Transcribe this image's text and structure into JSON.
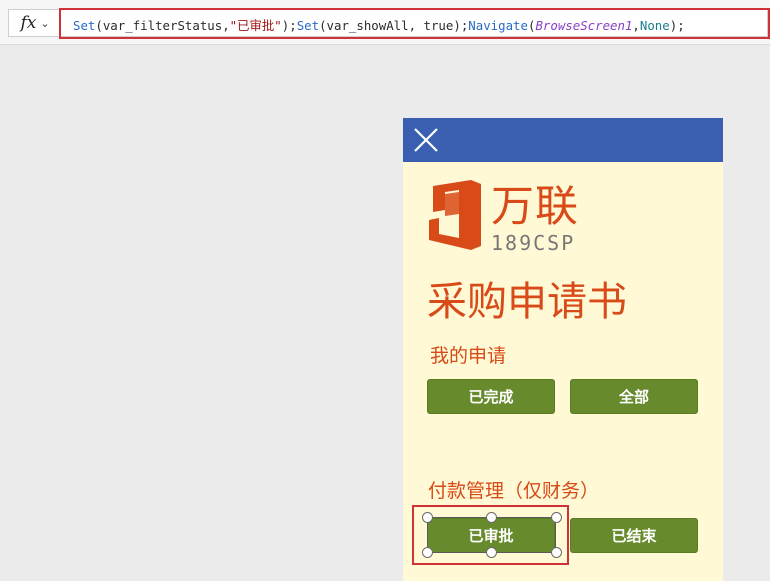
{
  "formula_bar": {
    "fx_label": "fx",
    "chevron_glyph": "⌄",
    "tokens": [
      {
        "t": "Set",
        "k": "fn"
      },
      {
        "t": "(var_filterStatus,",
        "k": "plain"
      },
      {
        "t": "\"已审批\"",
        "k": "str"
      },
      {
        "t": ");",
        "k": "plain"
      },
      {
        "t": "Set",
        "k": "fn"
      },
      {
        "t": "(var_showAll, ",
        "k": "plain"
      },
      {
        "t": "true",
        "k": "num"
      },
      {
        "t": ");",
        "k": "plain"
      },
      {
        "t": "Navigate",
        "k": "fn"
      },
      {
        "t": "(",
        "k": "plain"
      },
      {
        "t": "BrowseScreen1",
        "k": "ctrl"
      },
      {
        "t": ",",
        "k": "plain"
      },
      {
        "t": "None",
        "k": "kw"
      },
      {
        "t": ");",
        "k": "plain"
      }
    ]
  },
  "screen": {
    "header_color": "#3a5fb0",
    "background_color": "#fff9d6",
    "brand_name": "万联",
    "brand_sub": "189CSP",
    "title": "采购申请书",
    "section_my_requests": "我的申请",
    "btn_completed": "已完成",
    "btn_all": "全部",
    "section_payment": "付款管理（仅财务）",
    "btn_approved": "已审批",
    "btn_ended": "已结束",
    "button_color": "#668a2c",
    "accent_color": "#d84a18"
  }
}
